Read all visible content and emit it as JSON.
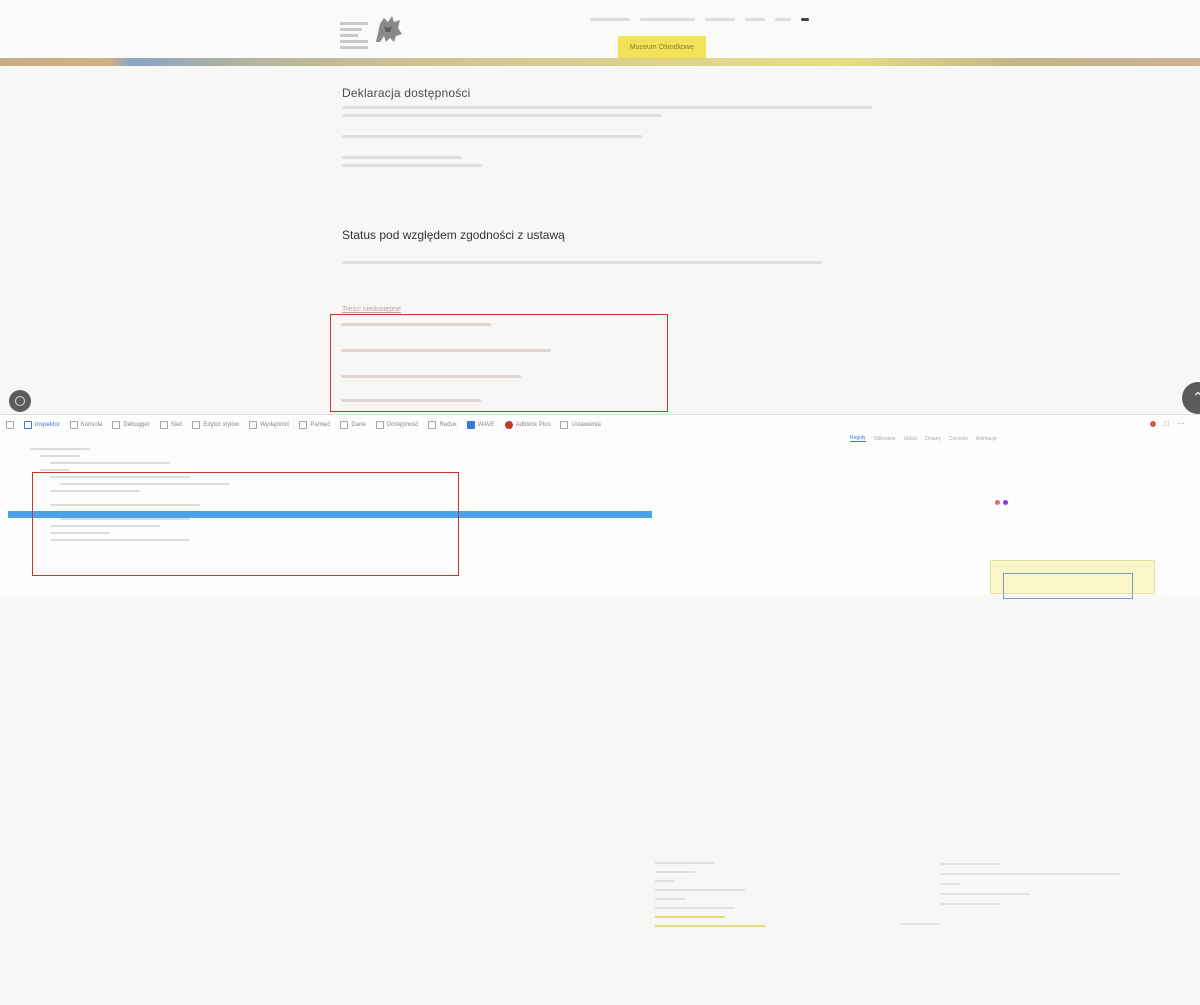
{
  "site": {
    "nav": [
      "",
      "Muzeum Ośrodkowe",
      "",
      ""
    ],
    "active_nav_index": 1
  },
  "content": {
    "title": "Deklaracja dostępności",
    "status_title": "Status pod względem zgodności z ustawą",
    "sub_link": "Treści niedostępne"
  },
  "devtools": {
    "tabs": [
      "Inspektor",
      "Konsola",
      "Debugger",
      "Sieć",
      "Edytor stylów",
      "Wydajność",
      "Pamięć",
      "Dane",
      "Dostępność",
      "Redux",
      "WAVE",
      "Adblock Plus",
      "Ustawienia"
    ],
    "active_tab_index": 0,
    "panel_tabs": [
      "Reguły",
      "Obliczone",
      "Układ",
      "Zmiany",
      "Czcionki",
      "Animacje"
    ],
    "active_panel_index": 0
  },
  "colors": {
    "accent_nav": "#f1e25a",
    "highlight_line": "#4aa3e8",
    "annotation_box": "#c0392b"
  }
}
